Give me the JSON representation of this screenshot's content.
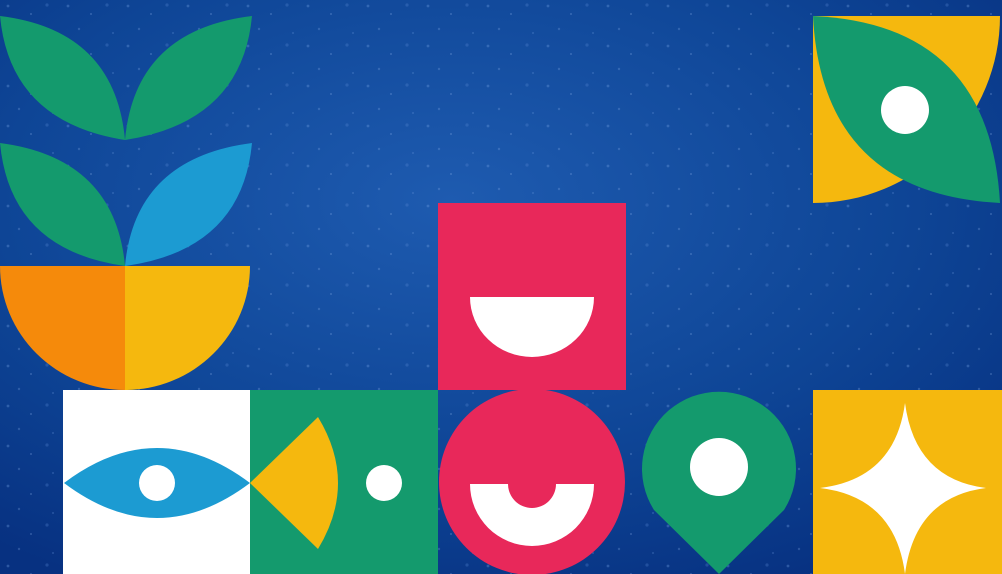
{
  "artwork": {
    "background_color": "#0a3d8f",
    "colors": {
      "navy": "#0a3d8f",
      "green": "#149a6d",
      "blue": "#1c9bd2",
      "orange": "#f58a0b",
      "yellow": "#f5b80e",
      "red": "#e8285a",
      "white": "#ffffff"
    },
    "motifs": [
      {
        "name": "potted-plant-icon",
        "colors": [
          "green",
          "blue",
          "orange",
          "yellow"
        ]
      },
      {
        "name": "eye-icon",
        "colors": [
          "white",
          "blue"
        ]
      },
      {
        "name": "fish-tail-icon",
        "colors": [
          "green",
          "yellow",
          "white"
        ]
      },
      {
        "name": "smile-square-icon",
        "colors": [
          "red",
          "white"
        ]
      },
      {
        "name": "smile-circle-icon",
        "colors": [
          "red",
          "white"
        ]
      },
      {
        "name": "map-pin-icon",
        "colors": [
          "green",
          "white"
        ]
      },
      {
        "name": "sparkle-star-icon",
        "colors": [
          "yellow",
          "white"
        ]
      },
      {
        "name": "leaf-eye-icon",
        "colors": [
          "yellow",
          "green",
          "white"
        ]
      }
    ]
  }
}
